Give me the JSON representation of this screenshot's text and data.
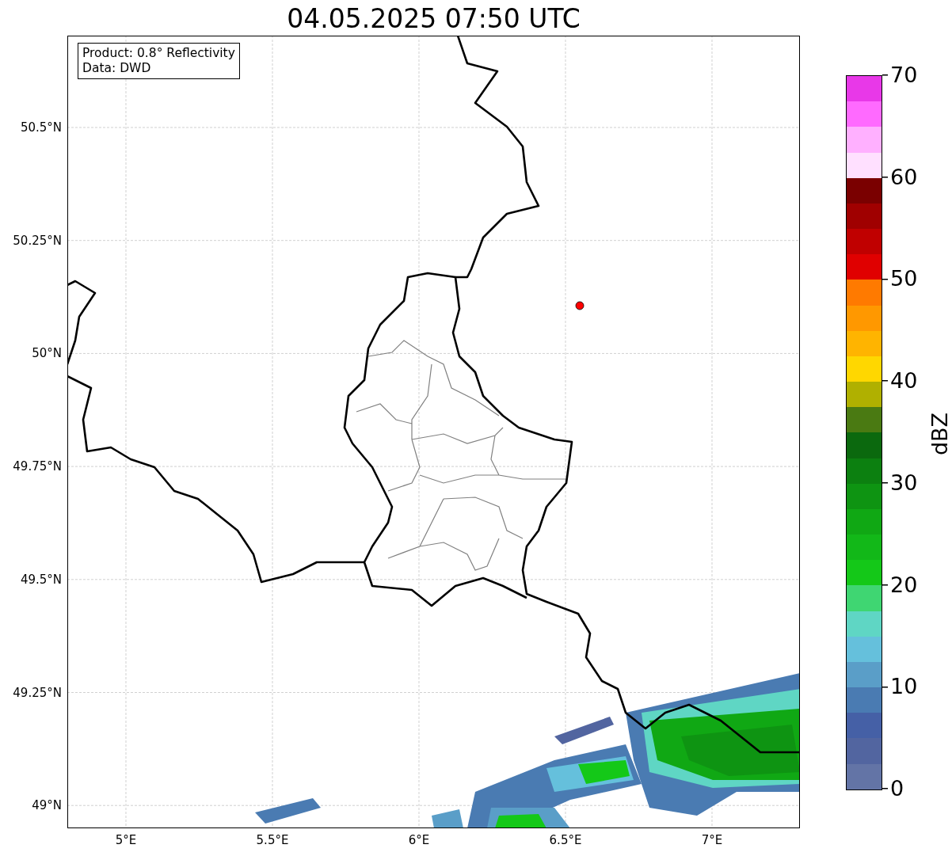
{
  "title": "04.05.2025 07:50 UTC",
  "info_box": [
    "Product: 0.8° Reflectivity",
    "Data: DWD"
  ],
  "map": {
    "y_ticks": [
      "50.5°N",
      "50.25°N",
      "50°N",
      "49.75°N",
      "49.5°N",
      "49.25°N",
      "49°N"
    ],
    "x_ticks": [
      "5°E",
      "5.5°E",
      "6°E",
      "6.5°E",
      "7°E"
    ],
    "radar_site": {
      "color": "#ff0000"
    }
  },
  "colorbar": {
    "label": "dBZ",
    "ticks": [
      "70",
      "60",
      "50",
      "40",
      "30",
      "20",
      "10",
      "0"
    ],
    "segments": [
      {
        "color": "#6374a6"
      },
      {
        "color": "#5265a0"
      },
      {
        "color": "#4560a6"
      },
      {
        "color": "#4a7bb2"
      },
      {
        "color": "#5a9ec8"
      },
      {
        "color": "#65c0dc"
      },
      {
        "color": "#5fd6c4"
      },
      {
        "color": "#3fd672"
      },
      {
        "color": "#14c818"
      },
      {
        "color": "#12b818"
      },
      {
        "color": "#10a814"
      },
      {
        "color": "#0e9412"
      },
      {
        "color": "#0c8010"
      },
      {
        "color": "#0b690e"
      },
      {
        "color": "#4a7a12"
      },
      {
        "color": "#b0b000"
      },
      {
        "color": "#ffd700"
      },
      {
        "color": "#ffb400"
      },
      {
        "color": "#ff9800"
      },
      {
        "color": "#ff7a00"
      },
      {
        "color": "#e00000"
      },
      {
        "color": "#c00000"
      },
      {
        "color": "#a00000"
      },
      {
        "color": "#7a0000"
      },
      {
        "color": "#ffe0ff"
      },
      {
        "color": "#ffb0ff"
      },
      {
        "color": "#ff6aff"
      },
      {
        "color": "#e838e8"
      }
    ]
  }
}
